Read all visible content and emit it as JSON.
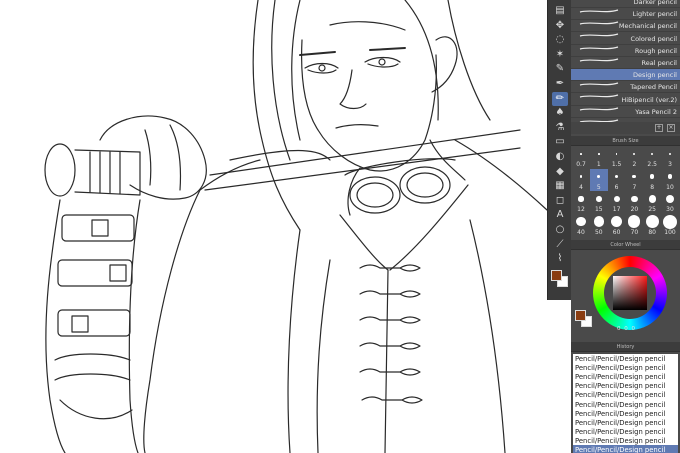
{
  "app": {
    "accent_color": "#5f7ab3",
    "main_color": "#8a3d12",
    "sub_color": "#ffffff"
  },
  "toolbar": {
    "tools": [
      "layer-icon",
      "move-icon",
      "lasso-icon",
      "wand-icon",
      "eyedropper-icon",
      "pen-icon",
      "pencil-icon",
      "brush-icon",
      "airbrush-icon",
      "eraser-icon",
      "blend-icon",
      "fill-icon",
      "gradient-icon",
      "figure-icon",
      "text-icon",
      "balloon-icon",
      "ruler-icon",
      "correct-line-icon"
    ],
    "active_tool": "pencil-icon"
  },
  "sub_tool": {
    "brushes": [
      {
        "label": "Darker pencil"
      },
      {
        "label": "Lighter pencil"
      },
      {
        "label": "Mechanical pencil"
      },
      {
        "label": "Colored pencil"
      },
      {
        "label": "Rough pencil"
      },
      {
        "label": "Real pencil"
      },
      {
        "label": "Design pencil",
        "selected": true
      },
      {
        "label": "Tapered Pencil"
      },
      {
        "label": "HiBipencil (ver.2)"
      },
      {
        "label": "Yasa Pencil 2"
      }
    ]
  },
  "brush_size": {
    "title": "Brush Size",
    "sizes": [
      "0.7",
      "1",
      "1.5",
      "2",
      "2.5",
      "3",
      "4",
      "5",
      "6",
      "7",
      "8",
      "10",
      "12",
      "15",
      "17",
      "20",
      "25",
      "30",
      "40",
      "50",
      "60",
      "70",
      "80",
      "100"
    ],
    "selected": "5"
  },
  "color_wheel": {
    "title": "Color Wheel",
    "values": "0  0  0"
  },
  "history": {
    "title": "History",
    "items": [
      "Pencil/Pencil/Design pencil",
      "Pencil/Pencil/Design pencil",
      "Pencil/Pencil/Design pencil",
      "Pencil/Pencil/Design pencil",
      "Pencil/Pencil/Design pencil",
      "Pencil/Pencil/Design pencil",
      "Pencil/Pencil/Design pencil",
      "Pencil/Pencil/Design pencil",
      "Pencil/Pencil/Design pencil",
      "Pencil/Pencil/Design pencil",
      "Pencil/Pencil/Design pencil"
    ]
  }
}
